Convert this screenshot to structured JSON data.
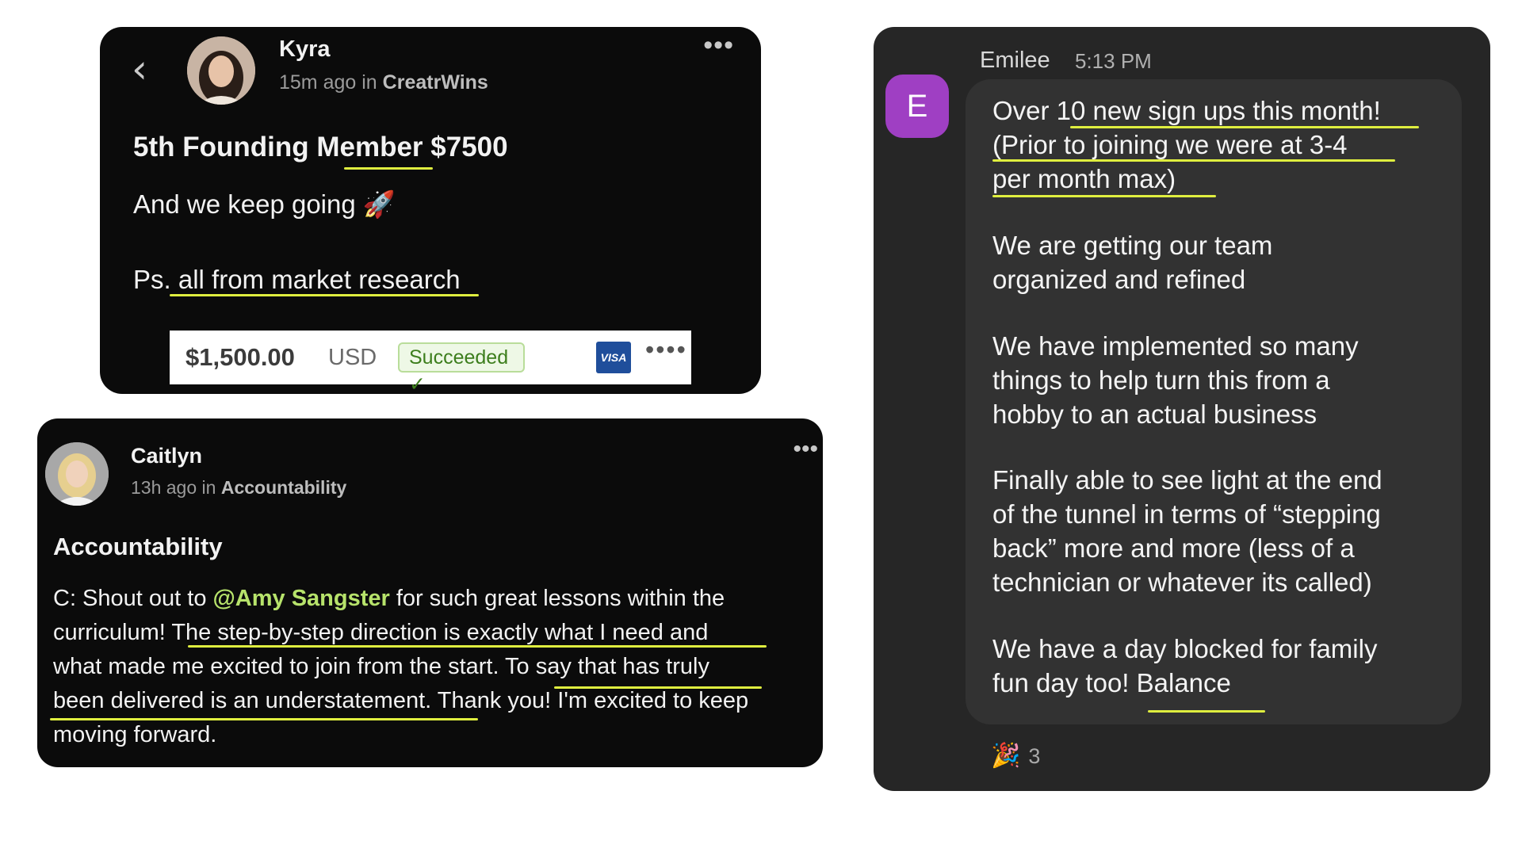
{
  "kyra_post": {
    "author": "Kyra",
    "time": "15m ago",
    "in_word": "in",
    "community": "CreatrWins",
    "menu": "•••",
    "back": "‹",
    "title": "5th Founding Member $7500",
    "line1": "And we keep going 🚀",
    "line2": "Ps. all from market research",
    "payment": {
      "amount": "$1,500.00",
      "currency": "USD",
      "status": "Succeeded ✓",
      "card_brand": "VISA",
      "more": "••••"
    }
  },
  "caitlyn_post": {
    "author": "Caitlyn",
    "time": "13h ago",
    "in_word": "in",
    "community": "Accountability",
    "menu": "•••",
    "title": "Accountability",
    "line1_a": "C: Shout out to ",
    "mention": "@Amy Sangster",
    "line1_b": " for such great lessons within the",
    "line2": "curriculum! The step-by-step direction is exactly what I need and",
    "line3": "what made me excited to join from the start. To say that has truly",
    "line4": "been delivered is an understatement. Thank you! I'm excited to keep",
    "line5": "moving forward."
  },
  "emilee_message": {
    "avatar_letter": "E",
    "author": "Emilee",
    "time": "5:13 PM",
    "p1": [
      "Over 10 new sign ups this month!",
      "(Prior to joining we were at 3-4",
      "per month max)"
    ],
    "p2": [
      "We are getting our team",
      "organized and refined"
    ],
    "p3": [
      "We have implemented so many",
      "things to help turn this from a",
      "hobby to an actual business"
    ],
    "p4": [
      "Finally able to see light at the end",
      "of the tunnel in terms of “stepping",
      "back” more and more (less of a",
      "technician or whatever its called)"
    ],
    "p5": [
      "We have a day blocked for family",
      "fun day too! Balance"
    ],
    "reaction_emoji": "🎉",
    "reaction_count": "3"
  },
  "colors": {
    "highlight": "#dfee3f",
    "card_dark": "#0b0b0b",
    "chat_bg": "#262626",
    "avatar_purple": "#9f3fc3",
    "mention_green": "#b7e36b"
  }
}
